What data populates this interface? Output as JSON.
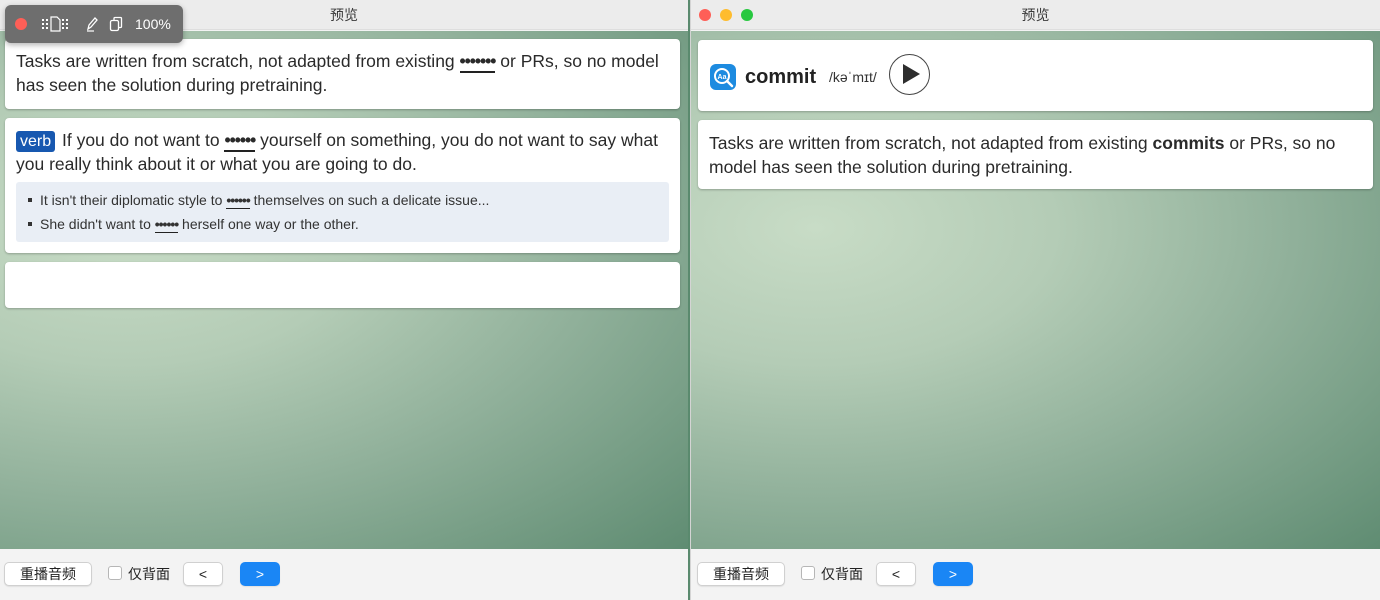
{
  "left_window": {
    "title": "预览",
    "toolbar": {
      "zoom": "100%"
    },
    "front_card": {
      "before": "Tasks are written from scratch, not adapted from existing ",
      "cloze": "•••••••",
      "after": " or PRs, so no model has seen the solution during pretraining."
    },
    "definition_card": {
      "pos": "verb",
      "before": " If you do not want to ",
      "cloze": "••••••",
      "after": " yourself on something, you do not want to say what you really think about it or what you are going to do.",
      "examples": [
        {
          "before": "It isn't their diplomatic style to ",
          "cloze": "••••••",
          "after": " themselves on such a delicate issue..."
        },
        {
          "before": "She didn't want to ",
          "cloze": "••••••",
          "after": " herself one way or the other."
        }
      ]
    },
    "bottom_bar": {
      "replay_label": "重播音频",
      "back_only_label": "仅背面",
      "prev_label": "<",
      "next_label": ">"
    }
  },
  "right_window": {
    "title": "预览",
    "word_card": {
      "word": "commit",
      "phonetic": "/kəˈmɪt/",
      "play_icon": "play-icon"
    },
    "sentence_card": {
      "before": "Tasks are written from scratch, not adapted from existing ",
      "bold": "commits",
      "after": " or PRs, so no model has seen the solution during pretraining."
    },
    "bottom_bar": {
      "replay_label": "重播音频",
      "back_only_label": "仅背面",
      "prev_label": "<",
      "next_label": ">"
    }
  },
  "colors": {
    "accent_blue": "#1a86f5",
    "badge_blue": "#1758b0",
    "close_red": "#fe5f57",
    "minimize_yellow": "#febc2e",
    "zoom_green": "#28c840"
  }
}
